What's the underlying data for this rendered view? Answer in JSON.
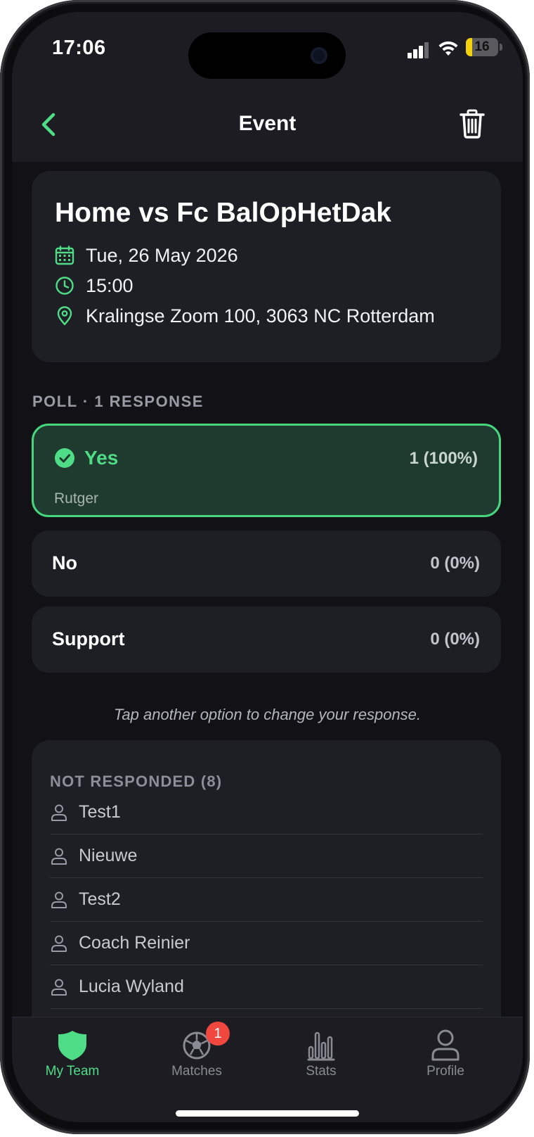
{
  "status_bar": {
    "time": "17:06",
    "battery": "16"
  },
  "nav": {
    "title": "Event"
  },
  "event": {
    "title": "Home vs Fc BalOpHetDak",
    "date": "Tue, 26 May 2026",
    "time": "15:00",
    "location": "Kralingse Zoom 100, 3063 NC Rotterdam"
  },
  "poll": {
    "label": "POLL · 1 RESPONSE",
    "options": [
      {
        "label": "Yes",
        "count": "1 (100%)",
        "voters": "Rutger",
        "selected": true
      },
      {
        "label": "No",
        "count": "0 (0%)"
      },
      {
        "label": "Support",
        "count": "0 (0%)"
      }
    ],
    "hint": "Tap another option to change your response."
  },
  "not_responded": {
    "title": "NOT RESPONDED (8)",
    "names": [
      "Test1",
      "Nieuwe",
      "Test2",
      "Coach Reinier",
      "Lucia Wyland"
    ]
  },
  "tabs": [
    {
      "label": "My Team",
      "icon": "shield-icon",
      "active": true
    },
    {
      "label": "Matches",
      "icon": "soccer-ball-icon",
      "badge": "1"
    },
    {
      "label": "Stats",
      "icon": "bar-chart-icon"
    },
    {
      "label": "Profile",
      "icon": "person-icon"
    }
  ],
  "colors": {
    "accent": "#4fdc86",
    "background": "#121216",
    "card": "#1e1e25",
    "badge": "#f0473f"
  }
}
